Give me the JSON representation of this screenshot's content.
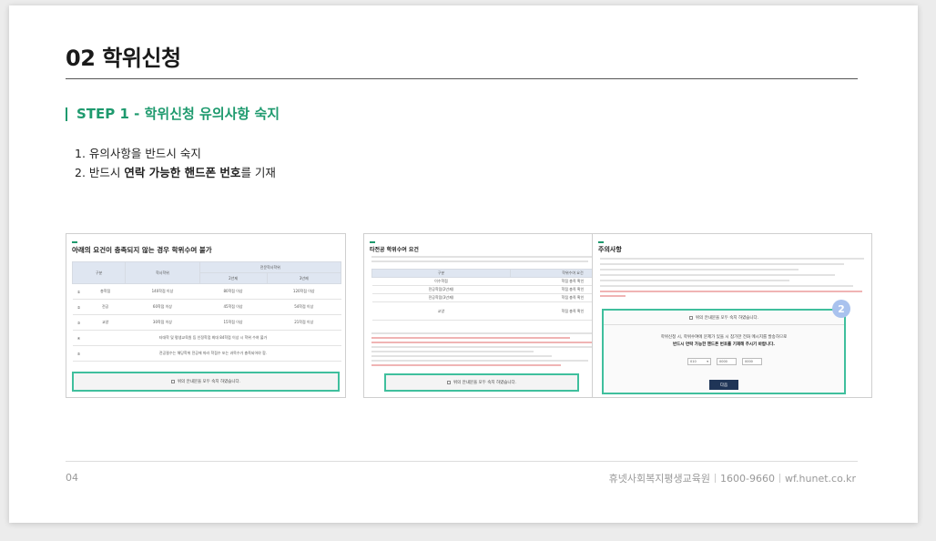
{
  "header": {
    "title": "02  학위신청"
  },
  "step": {
    "label": "STEP 1 - 학위신청 유의사항 숙지"
  },
  "instructions": {
    "item1": "1. 유의사항을 반드시 숙지",
    "item2_pre": "2. 반드시 ",
    "item2_bold": "연락 가능한 핸드폰 번호",
    "item2_post": "를 기재"
  },
  "shot1": {
    "heading": "아래의 요건이 충족되지 않는 경우 학위수여 불가",
    "col_type": "구분",
    "col_credits": "학사학위",
    "col_major": "전문학사학위",
    "col_y2": "2년제",
    "col_y3": "3년제",
    "rows": [
      {
        "no": "①",
        "type": "총학점",
        "a": "140학점 이상",
        "b": "80학점 이상",
        "c": "120학점 이상"
      },
      {
        "no": "②",
        "type": "전공",
        "a": "60학점 이상",
        "b": "45학점 이상",
        "c": "54학점 이상"
      },
      {
        "no": "③",
        "type": "교양",
        "a": "30학점 이상",
        "b": "15학점 이상",
        "c": "21학점 이상"
      }
    ],
    "row4_no": "④",
    "row4": "타대학 및 평생교육원 등 인정학점 최대 84학점 이상 시 학위 수여 불가",
    "row5_no": "⑤",
    "row5": "전공필수는 해당학위 전공에 따라 학점수 또는 과목수가 충족되어야 함.",
    "agree": "위의 안내문을 모두 숙지 하였습니다."
  },
  "shot2": {
    "heading": "타전공 학위수여 요건",
    "col_a": "구분",
    "col_b": "학위수여 요건",
    "rows": [
      {
        "a": "이수학점",
        "b": "학점 충족 확인"
      },
      {
        "a": "전공학점(2년제)",
        "b": "학점 충족 확인"
      },
      {
        "a": "전공학점(3년제)",
        "b": "학점 충족 확인"
      },
      {
        "a": "교양",
        "b": "학점 충족 확인"
      }
    ],
    "agree": "위의 안내문을 모두 숙지 하였습니다."
  },
  "shot3": {
    "heading": "주의사항",
    "badge": "2",
    "check": "위의 안내문을 모두 숙지 하였습니다.",
    "notice1": "학위신청 시, 학위수여에 문제가 있을 시 참가한 전화 메시지를 발송하므로",
    "notice2": "반드시 연락 가능한 핸드폰 번호를 기재해 주시기 바랍니다.",
    "phone1": "010",
    "phone2": "0000",
    "phone3": "0000",
    "next": "다음"
  },
  "footer": {
    "page": "04",
    "org": "휴넷사회복지평생교육원",
    "phone": "1600-9660",
    "url": "wf.hunet.co.kr"
  }
}
